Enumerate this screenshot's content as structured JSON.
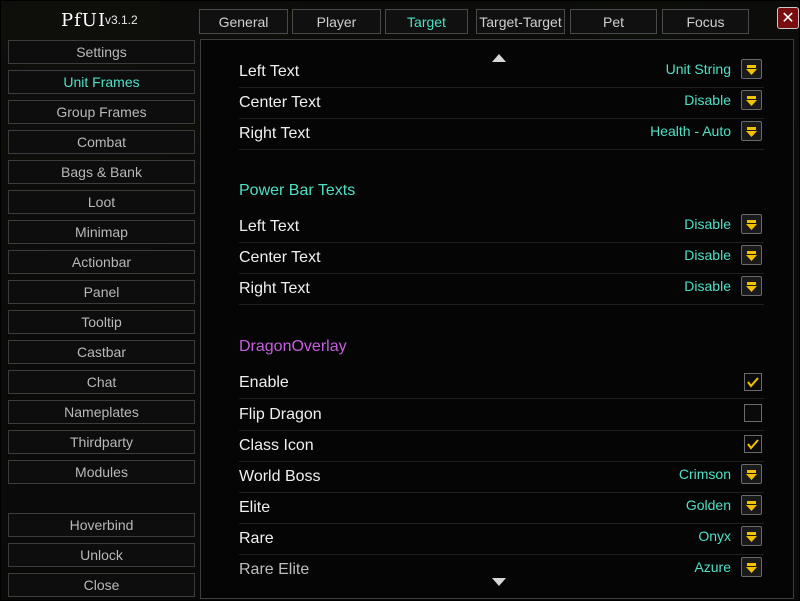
{
  "app": {
    "logo": "PfUI",
    "version": "v3.1.2"
  },
  "tabs": [
    {
      "label": "General"
    },
    {
      "label": "Player"
    },
    {
      "label": "Target"
    },
    {
      "label": "Target-Target"
    },
    {
      "label": "Pet"
    },
    {
      "label": "Focus"
    }
  ],
  "active_tab": "Target",
  "close_glyph": "✕",
  "sidebar": {
    "items": [
      {
        "label": "Settings"
      },
      {
        "label": "Unit Frames"
      },
      {
        "label": "Group Frames"
      },
      {
        "label": "Combat"
      },
      {
        "label": "Bags & Bank"
      },
      {
        "label": "Loot"
      },
      {
        "label": "Minimap"
      },
      {
        "label": "Actionbar"
      },
      {
        "label": "Panel"
      },
      {
        "label": "Tooltip"
      },
      {
        "label": "Castbar"
      },
      {
        "label": "Chat"
      },
      {
        "label": "Nameplates"
      },
      {
        "label": "Thirdparty"
      },
      {
        "label": "Modules"
      }
    ],
    "bottom": [
      {
        "label": "Hoverbind"
      },
      {
        "label": "Unlock"
      },
      {
        "label": "Close"
      }
    ],
    "active": "Unit Frames"
  },
  "content": {
    "health_rows": [
      {
        "label": "Left Text",
        "value": "Unit String"
      },
      {
        "label": "Center Text",
        "value": "Disable"
      },
      {
        "label": "Right Text",
        "value": "Health - Auto"
      }
    ],
    "power_section": {
      "title": "Power Bar Texts"
    },
    "power_rows": [
      {
        "label": "Left Text",
        "value": "Disable"
      },
      {
        "label": "Center Text",
        "value": "Disable"
      },
      {
        "label": "Right Text",
        "value": "Disable"
      }
    ],
    "dragon_section": {
      "title": "DragonOverlay"
    },
    "dragon_checks": [
      {
        "label": "Enable",
        "checked": true
      },
      {
        "label": "Flip Dragon",
        "checked": false
      },
      {
        "label": "Class Icon",
        "checked": true
      }
    ],
    "dragon_rows": [
      {
        "label": "World Boss",
        "value": "Crimson"
      },
      {
        "label": "Elite",
        "value": "Golden"
      },
      {
        "label": "Rare",
        "value": "Onyx"
      },
      {
        "label": "Rare Elite",
        "value": "Azure"
      }
    ]
  },
  "colors": {
    "accent": "#4fe0c6",
    "section_power": "#4fe0c6",
    "section_dragon": "#c65ee0",
    "check": "#f2c200",
    "dropdown_arrow": "#f2c200"
  }
}
